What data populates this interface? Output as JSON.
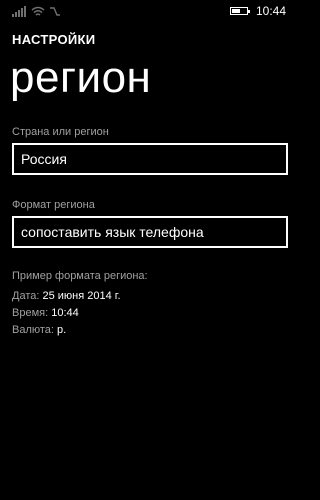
{
  "status_bar": {
    "time": "10:44",
    "battery_level": 0.6,
    "icons": [
      "signal-icon",
      "wifi-icon",
      "nfc-icon",
      "battery-icon"
    ]
  },
  "header": {
    "section": "НАСТРОЙКИ",
    "title": "регион"
  },
  "country": {
    "label": "Страна или регион",
    "value": "Россия"
  },
  "region_format": {
    "label": "Формат региона",
    "value": "сопоставить язык телефона"
  },
  "sample": {
    "title": "Пример формата региона:",
    "date_label": "Дата:",
    "date_value": "25  июня 2014 г.",
    "time_label": "Время:",
    "time_value": "10:44",
    "currency_label": "Валюта:",
    "currency_value": "р."
  },
  "colors": {
    "background": "#000000",
    "text": "#ffffff",
    "secondary_text": "#a0a0a0"
  }
}
